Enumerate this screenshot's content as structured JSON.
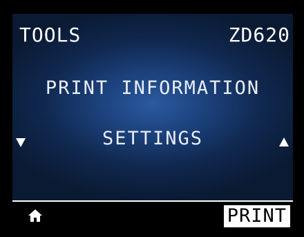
{
  "header": {
    "menu_title": "TOOLS",
    "model": "ZD620"
  },
  "menu": {
    "items": [
      {
        "label": "PRINT INFORMATION"
      },
      {
        "label": "SETTINGS"
      }
    ],
    "nav_down_icon": "triangle-down",
    "nav_up_icon": "triangle-up"
  },
  "footer": {
    "home_icon": "home",
    "print_label": "PRINT"
  },
  "colors": {
    "background_center": "#2a5aa0",
    "background_edge": "#0a1a33",
    "text": "#ffffff",
    "button_bg": "#ffffff",
    "button_text": "#000000"
  }
}
